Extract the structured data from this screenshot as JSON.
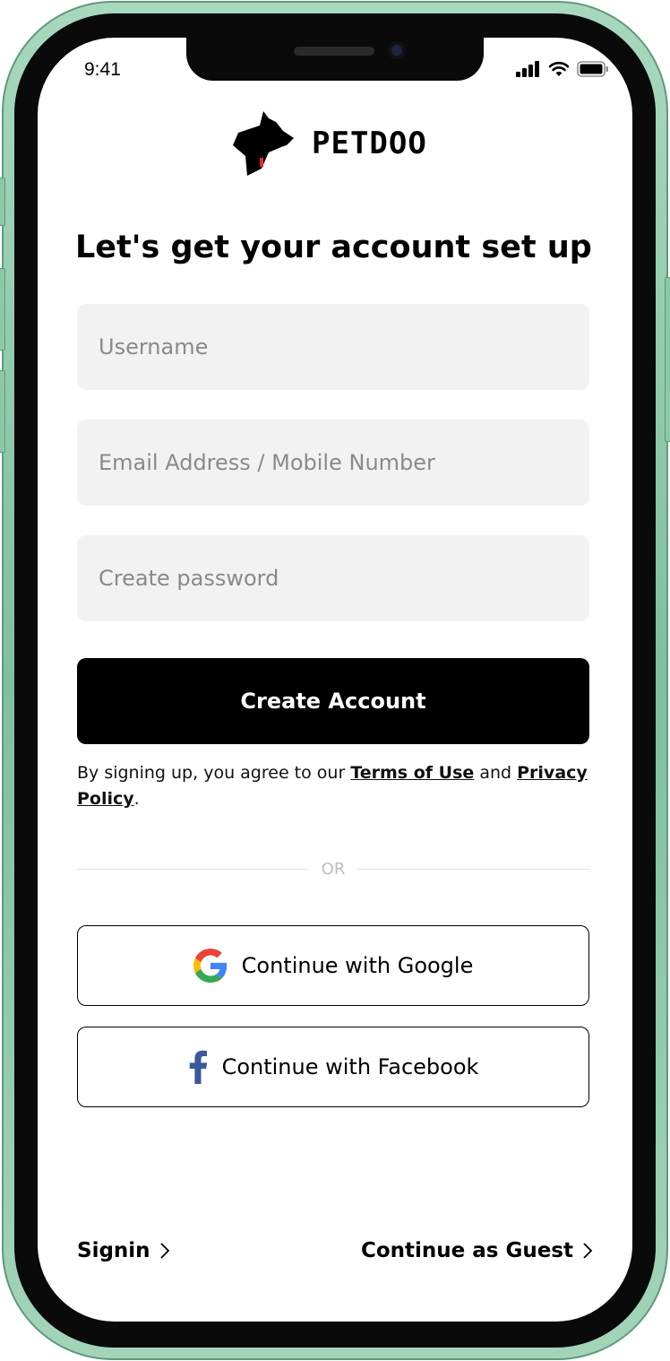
{
  "status_bar": {
    "time": "9:41",
    "icons": [
      "cellular-signal-icon",
      "wifi-icon",
      "battery-icon"
    ]
  },
  "brand": {
    "name": "PETDOO",
    "logo_icon": "dog-head-icon",
    "accent_color": "#e3262f"
  },
  "signup": {
    "heading": "Let's get your account set up",
    "username_placeholder": "Username",
    "email_placeholder": "Email Address / Mobile Number",
    "password_placeholder": "Create password",
    "create_label": "Create Account",
    "terms_prefix": "By signing up, you agree to our ",
    "terms_link": "Terms of Use",
    "terms_and": " and ",
    "privacy_link": "Privacy Policy",
    "terms_suffix": "."
  },
  "divider": {
    "label": "OR"
  },
  "social": {
    "google_label": "Continue with Google",
    "facebook_label": "Continue with Facebook",
    "facebook_color": "#3b5998"
  },
  "footer": {
    "signin_label": "Signin",
    "guest_label": "Continue as Guest"
  },
  "theme": {
    "button_bg": "#000000",
    "input_bg": "#f2f2f2",
    "frame_color": "#8cc7a7"
  }
}
